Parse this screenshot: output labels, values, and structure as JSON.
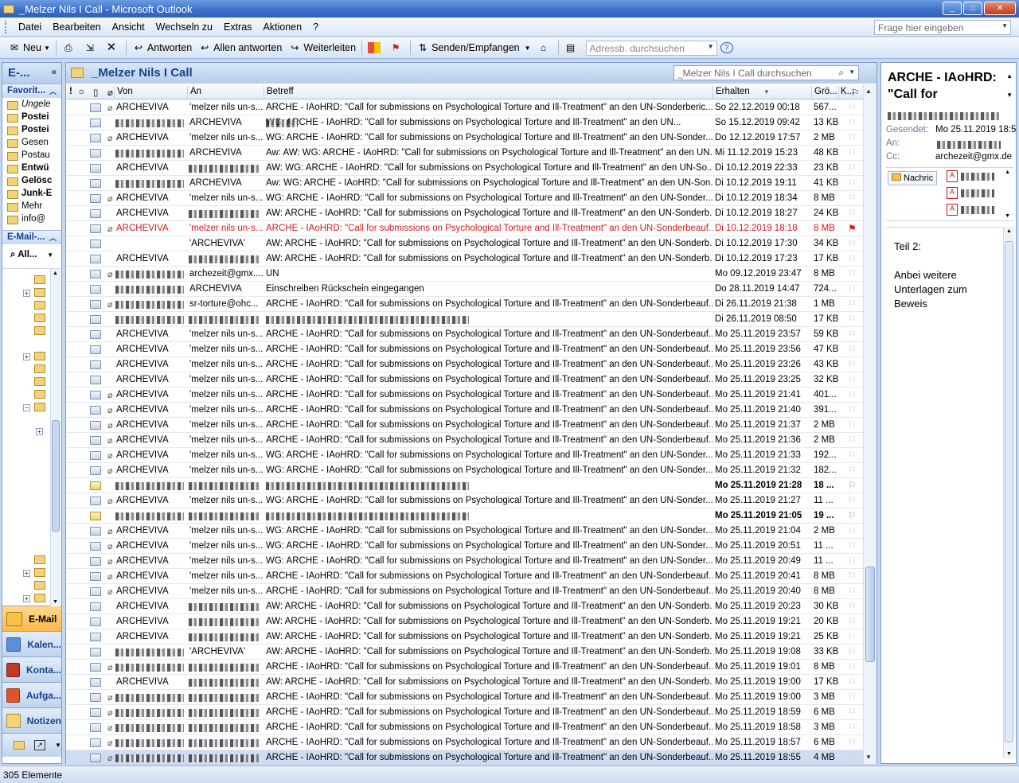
{
  "window": {
    "title": "_Melzer Nils I Call - Microsoft Outlook",
    "min": "_",
    "max": "□",
    "close": "✕"
  },
  "menu": {
    "items": [
      "Datei",
      "Bearbeiten",
      "Ansicht",
      "Wechseln zu",
      "Extras",
      "Aktionen",
      "?"
    ],
    "ask_placeholder": "Frage hier eingeben"
  },
  "toolbar": {
    "new": "Neu",
    "reply": "Antworten",
    "reply_all": "Allen antworten",
    "forward": "Weiterleiten",
    "send_receive": "Senden/Empfangen",
    "address_search": "Adressb. durchsuchen"
  },
  "nav": {
    "header": "E-...",
    "favorites_title": "Favorit...",
    "favorites": [
      "Ungele",
      "Postei",
      "Postei",
      "Gesen",
      "Postau",
      "Entwü",
      "Gelösc",
      "Junk-E",
      "Mehr",
      "info@"
    ],
    "mail_title": "E-Mail-...",
    "all_label": "All...",
    "buttons": [
      "E-Mail",
      "Kalen...",
      "Konta...",
      "Aufga...",
      "Notizen"
    ],
    "colors": {
      "mail": "#f6c24a",
      "calendar": "#5b8fd6",
      "contacts": "#c0392b",
      "tasks": "#e0542a",
      "notes": "#f3d27a"
    }
  },
  "list": {
    "folder_title": "_Melzer Nils I Call",
    "search_placeholder": "_Melzer Nils I Call durchsuchen",
    "columns": {
      "from": "Von",
      "to": "An",
      "subject": "Betreff",
      "received": "Erhalten",
      "size": "Grö...",
      "cat": "K..."
    },
    "rows": [
      {
        "from": "ARCHEVIVA",
        "to": "'melzer nils un-s...",
        "subject": "ARCHE - IAoHRD: \"Call for submissions on Psychological Torture and Ill-Treatment\" an den UN-Sonderberic...",
        "date": "So 22.12.2019 00:18",
        "size": "567...",
        "att": true
      },
      {
        "from": "",
        "to": "ARCHEVIVA",
        "subject": "WG: ARCHE - IAoHRD: \"Call for submissions on Psychological Torture and Ill-Treatment\" an den UN...",
        "date": "So 15.12.2019 09:42",
        "size": "13 KB",
        "att": false,
        "blurfrom": true,
        "blursubj": true
      },
      {
        "from": "ARCHEVIVA",
        "to": "'melzer nils un-s...",
        "subject": "WG: ARCHE - IAoHRD: \"Call for submissions on Psychological Torture and Ill-Treatment\" an den UN-Sonder...",
        "date": "Do 12.12.2019 17:57",
        "size": "2 MB",
        "att": true
      },
      {
        "from": "",
        "to": "ARCHEVIVA",
        "subject": "Aw: AW: WG: ARCHE - IAoHRD: \"Call for submissions on Psychological Torture and Ill-Treatment\" an den UN...",
        "date": "Mi 11.12.2019 15:23",
        "size": "48 KB",
        "att": false,
        "blurfrom": true
      },
      {
        "from": "ARCHEVIVA",
        "to": "",
        "subject": "AW: WG: ARCHE - IAoHRD: \"Call for submissions on Psychological Torture and Ill-Treatment\" an den UN-So...",
        "date": "Di 10.12.2019 22:33",
        "size": "23 KB",
        "att": false,
        "blurto": true
      },
      {
        "from": "",
        "to": "ARCHEVIVA",
        "subject": "Aw: WG: ARCHE - IAoHRD: \"Call for submissions on Psychological Torture and Ill-Treatment\" an den UN-Son...",
        "date": "Di 10.12.2019 19:11",
        "size": "41 KB",
        "att": false,
        "blurfrom": true
      },
      {
        "from": "ARCHEVIVA",
        "to": "'melzer nils un-s...",
        "subject": "WG: ARCHE - IAoHRD: \"Call for submissions on Psychological Torture and Ill-Treatment\" an den UN-Sonder...",
        "date": "Di 10.12.2019 18:34",
        "size": "8 MB",
        "att": true
      },
      {
        "from": "ARCHEVIVA",
        "to": "",
        "subject": "AW: ARCHE - IAoHRD: \"Call for submissions on Psychological Torture and Ill-Treatment\" an den UN-Sonderb...",
        "date": "Di 10.12.2019 18:27",
        "size": "24 KB",
        "att": false,
        "blurto": true
      },
      {
        "from": "ARCHEVIVA",
        "to": "'melzer nils un-s...",
        "subject": "ARCHE - IAoHRD: \"Call for submissions on Psychological Torture and Ill-Treatment\" an den UN-Sonderbeauf...",
        "date": "Di 10.12.2019 18:18",
        "size": "8 MB",
        "att": true,
        "red": true
      },
      {
        "from": "",
        "to": "'ARCHEVIVA'",
        "subject": "AW: ARCHE - IAoHRD: \"Call for submissions on Psychological Torture and Ill-Treatment\" an den UN-Sonderb...",
        "date": "Di 10.12.2019 17:30",
        "size": "34 KB",
        "att": false
      },
      {
        "from": "ARCHEVIVA",
        "to": "",
        "subject": "AW: ARCHE - IAoHRD: \"Call for submissions on Psychological Torture and Ill-Treatment\" an den UN-Sonderb...",
        "date": "Di 10.12.2019 17:23",
        "size": "17 KB",
        "att": false,
        "blurto": true
      },
      {
        "from": "",
        "to": "archezeit@gmx....",
        "subject": "UN",
        "date": "Mo 09.12.2019 23:47",
        "size": "8 MB",
        "att": true,
        "blurfrom": true
      },
      {
        "from": "",
        "to": "ARCHEVIVA",
        "subject": "Einschreiben Rückschein eingegangen",
        "date": "Do 28.11.2019 14:47",
        "size": "724...",
        "att": false,
        "blurfrom": true
      },
      {
        "from": "",
        "to": "sr-torture@ohc...",
        "subject": "ARCHE - IAoHRD: \"Call for submissions on Psychological Torture and Ill-Treatment\" an den UN-Sonderbeauf...",
        "date": "Di 26.11.2019 21:38",
        "size": "1 MB",
        "att": true,
        "blurfrom": true
      },
      {
        "from": "",
        "to": "",
        "subject": "",
        "date": "Di 26.11.2019 08:50",
        "size": "17 KB",
        "att": false,
        "blurfrom": true,
        "blurto": true,
        "blursubj": true
      },
      {
        "from": "ARCHEVIVA",
        "to": "'melzer nils un-s...",
        "subject": "ARCHE - IAoHRD: \"Call for submissions on Psychological Torture and Ill-Treatment\" an den UN-Sonderbeauf...",
        "date": "Mo 25.11.2019 23:57",
        "size": "59 KB",
        "att": false
      },
      {
        "from": "ARCHEVIVA",
        "to": "'melzer nils un-s...",
        "subject": "ARCHE - IAoHRD: \"Call for submissions on Psychological Torture and Ill-Treatment\" an den UN-Sonderbeauf...",
        "date": "Mo 25.11.2019 23:56",
        "size": "47 KB",
        "att": false
      },
      {
        "from": "ARCHEVIVA",
        "to": "'melzer nils un-s...",
        "subject": "ARCHE - IAoHRD: \"Call for submissions on Psychological Torture and Ill-Treatment\" an den UN-Sonderbeauf...",
        "date": "Mo 25.11.2019 23:26",
        "size": "43 KB",
        "att": false
      },
      {
        "from": "ARCHEVIVA",
        "to": "'melzer nils un-s...",
        "subject": "ARCHE - IAoHRD: \"Call for submissions on Psychological Torture and Ill-Treatment\" an den UN-Sonderbeauf...",
        "date": "Mo 25.11.2019 23:25",
        "size": "32 KB",
        "att": false
      },
      {
        "from": "ARCHEVIVA",
        "to": "'melzer nils un-s...",
        "subject": "ARCHE - IAoHRD: \"Call for submissions on Psychological Torture and Ill-Treatment\" an den UN-Sonderbeauf...",
        "date": "Mo 25.11.2019 21:41",
        "size": "401...",
        "att": true
      },
      {
        "from": "ARCHEVIVA",
        "to": "'melzer nils un-s...",
        "subject": "ARCHE - IAoHRD: \"Call for submissions on Psychological Torture and Ill-Treatment\" an den UN-Sonderbeauf...",
        "date": "Mo 25.11.2019 21:40",
        "size": "391...",
        "att": true
      },
      {
        "from": "ARCHEVIVA",
        "to": "'melzer nils un-s...",
        "subject": "ARCHE - IAoHRD: \"Call for submissions on Psychological Torture and Ill-Treatment\" an den UN-Sonderbeauf...",
        "date": "Mo 25.11.2019 21:37",
        "size": "2 MB",
        "att": true
      },
      {
        "from": "ARCHEVIVA",
        "to": "'melzer nils un-s...",
        "subject": "ARCHE - IAoHRD: \"Call for submissions on Psychological Torture and Ill-Treatment\" an den UN-Sonderbeauf...",
        "date": "Mo 25.11.2019 21:36",
        "size": "2 MB",
        "att": true
      },
      {
        "from": "ARCHEVIVA",
        "to": "'melzer nils un-s...",
        "subject": "WG: ARCHE - IAoHRD: \"Call for submissions on Psychological Torture and Ill-Treatment\" an den UN-Sonder...",
        "date": "Mo 25.11.2019 21:33",
        "size": "192...",
        "att": true
      },
      {
        "from": "ARCHEVIVA",
        "to": "'melzer nils un-s...",
        "subject": "WG: ARCHE - IAoHRD: \"Call for submissions on Psychological Torture and Ill-Treatment\" an den UN-Sonder...",
        "date": "Mo 25.11.2019 21:32",
        "size": "182...",
        "att": true
      },
      {
        "from": "",
        "to": "",
        "subject": "",
        "date": "Mo 25.11.2019 21:28",
        "size": "18 ...",
        "att": false,
        "unread": true,
        "blurfrom": true,
        "blurto": true,
        "blursubj": true
      },
      {
        "from": "ARCHEVIVA",
        "to": "'melzer nils un-s...",
        "subject": "WG: ARCHE - IAoHRD: \"Call for submissions on Psychological Torture and Ill-Treatment\" an den UN-Sonder...",
        "date": "Mo 25.11.2019 21:27",
        "size": "11 ...",
        "att": true
      },
      {
        "from": "",
        "to": "",
        "subject": "",
        "date": "Mo 25.11.2019 21:05",
        "size": "19 ...",
        "att": false,
        "unread": true,
        "blurfrom": true,
        "blurto": true,
        "blursubj": true
      },
      {
        "from": "ARCHEVIVA",
        "to": "'melzer nils un-s...",
        "subject": "WG: ARCHE - IAoHRD: \"Call for submissions on Psychological Torture and Ill-Treatment\" an den UN-Sonder...",
        "date": "Mo 25.11.2019 21:04",
        "size": "2 MB",
        "att": true
      },
      {
        "from": "ARCHEVIVA",
        "to": "'melzer nils un-s...",
        "subject": "WG: ARCHE - IAoHRD: \"Call for submissions on Psychological Torture and Ill-Treatment\" an den UN-Sonder...",
        "date": "Mo 25.11.2019 20:51",
        "size": "11 ...",
        "att": true
      },
      {
        "from": "ARCHEVIVA",
        "to": "'melzer nils un-s...",
        "subject": "WG: ARCHE - IAoHRD: \"Call for submissions on Psychological Torture and Ill-Treatment\" an den UN-Sonder...",
        "date": "Mo 25.11.2019 20:49",
        "size": "11 ...",
        "att": true
      },
      {
        "from": "ARCHEVIVA",
        "to": "'melzer nils un-s...",
        "subject": "ARCHE - IAoHRD: \"Call for submissions on Psychological Torture and Ill-Treatment\" an den UN-Sonderbeauf...",
        "date": "Mo 25.11.2019 20:41",
        "size": "8 MB",
        "att": true
      },
      {
        "from": "ARCHEVIVA",
        "to": "'melzer nils un-s...",
        "subject": "ARCHE - IAoHRD: \"Call for submissions on Psychological Torture and Ill-Treatment\" an den UN-Sonderbeauf...",
        "date": "Mo 25.11.2019 20:40",
        "size": "8 MB",
        "att": true
      },
      {
        "from": "ARCHEVIVA",
        "to": "",
        "subject": "AW: ARCHE - IAoHRD: \"Call for submissions on Psychological Torture and Ill-Treatment\" an den UN-Sonderb...",
        "date": "Mo 25.11.2019 20:23",
        "size": "30 KB",
        "att": false,
        "blurto": true
      },
      {
        "from": "ARCHEVIVA",
        "to": "",
        "subject": "AW: ARCHE - IAoHRD: \"Call for submissions on Psychological Torture and Ill-Treatment\" an den UN-Sonderb...",
        "date": "Mo 25.11.2019 19:21",
        "size": "20 KB",
        "att": false,
        "blurto": true
      },
      {
        "from": "ARCHEVIVA",
        "to": "",
        "subject": "AW: ARCHE - IAoHRD: \"Call for submissions on Psychological Torture and Ill-Treatment\" an den UN-Sonderb...",
        "date": "Mo 25.11.2019 19:21",
        "size": "25 KB",
        "att": false,
        "blurto": true
      },
      {
        "from": "",
        "to": "'ARCHEVIVA'",
        "subject": "AW: ARCHE - IAoHRD: \"Call for submissions on Psychological Torture and Ill-Treatment\" an den UN-Sonderb...",
        "date": "Mo 25.11.2019 19:08",
        "size": "33 KB",
        "att": false,
        "blurfrom": true
      },
      {
        "from": "",
        "to": "",
        "subject": "ARCHE - IAoHRD: \"Call for submissions on Psychological Torture and Ill-Treatment\" an den UN-Sonderbeauf...",
        "date": "Mo 25.11.2019 19:01",
        "size": "8 MB",
        "att": true,
        "blurfrom": true,
        "blurto": true
      },
      {
        "from": "ARCHEVIVA",
        "to": "",
        "subject": "AW: ARCHE - IAoHRD: \"Call for submissions on Psychological Torture and Ill-Treatment\" an den UN-Sonderb...",
        "date": "Mo 25.11.2019 19:00",
        "size": "17 KB",
        "att": false,
        "blurto": true
      },
      {
        "from": "",
        "to": "",
        "subject": "ARCHE - IAoHRD: \"Call for submissions on Psychological Torture and Ill-Treatment\" an den UN-Sonderbeauf...",
        "date": "Mo 25.11.2019 19:00",
        "size": "3 MB",
        "att": true,
        "blurfrom": true,
        "blurto": true
      },
      {
        "from": "",
        "to": "",
        "subject": "ARCHE - IAoHRD: \"Call for submissions on Psychological Torture and Ill-Treatment\" an den UN-Sonderbeauf...",
        "date": "Mo 25.11.2019 18:59",
        "size": "6 MB",
        "att": true,
        "blurfrom": true,
        "blurto": true
      },
      {
        "from": "",
        "to": "",
        "subject": "ARCHE - IAoHRD: \"Call for submissions on Psychological Torture and Ill-Treatment\" an den UN-Sonderbeauf...",
        "date": "Mo 25.11.2019 18:58",
        "size": "3 MB",
        "att": true,
        "blurfrom": true,
        "blurto": true
      },
      {
        "from": "",
        "to": "",
        "subject": "ARCHE - IAoHRD: \"Call for submissions on Psychological Torture and Ill-Treatment\" an den UN-Sonderbeauf...",
        "date": "Mo 25.11.2019 18:57",
        "size": "6 MB",
        "att": true,
        "blurfrom": true,
        "blurto": true
      },
      {
        "from": "",
        "to": "",
        "subject": "ARCHE - IAoHRD: \"Call for submissions on Psychological Torture and Ill-Treatment\" an den UN-Sonderbeauf...",
        "date": "Mo 25.11.2019 18:55",
        "size": "4 MB",
        "att": true,
        "blurfrom": true,
        "blurto": true,
        "selected": true
      }
    ]
  },
  "reading": {
    "subject": "ARCHE - IAoHRD: \"Call for",
    "sent_label": "Gesendet:",
    "sent_value": "Mo 25.11.2019 18:5",
    "to_label": "An:",
    "cc_label": "Cc:",
    "cc_value": "archezeit@gmx.de",
    "attach_tab": "Nachric",
    "body": [
      "Teil 2:",
      "Anbei weitere Unterlagen zum Beweis"
    ]
  },
  "status": {
    "count": "305 Elemente"
  }
}
